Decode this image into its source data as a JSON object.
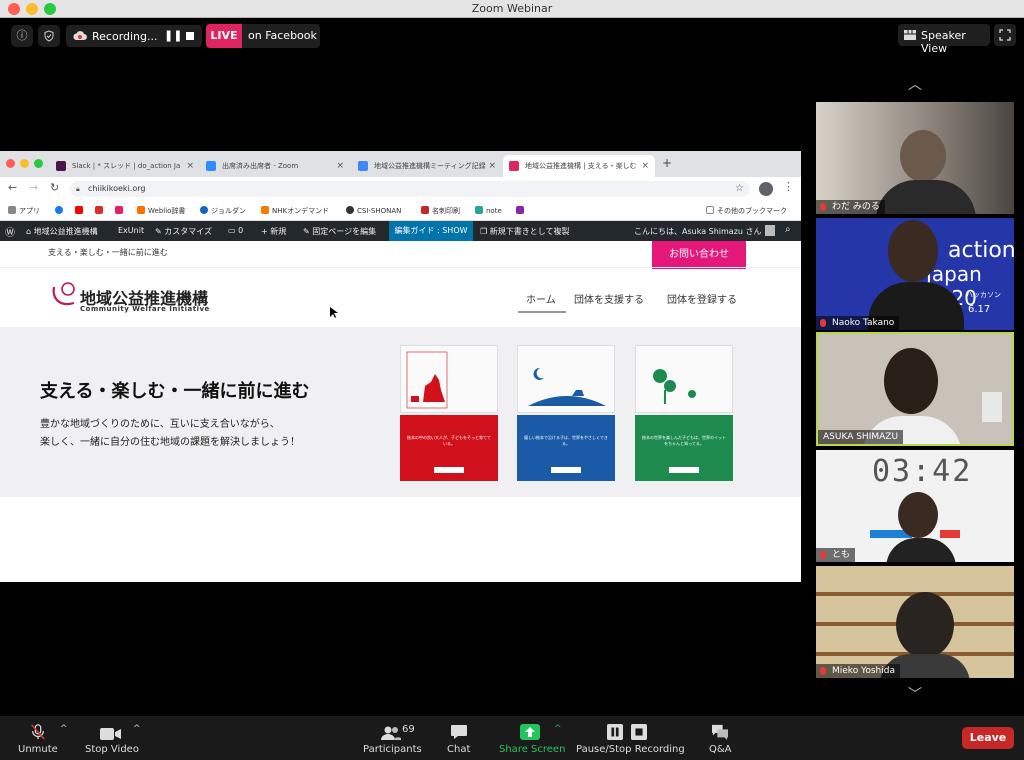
{
  "window": {
    "title": "Zoom Webinar"
  },
  "top_bar": {
    "recording_label": "Recording...",
    "live_label": "LIVE",
    "live_platform": "on Facebook",
    "view_label": "Speaker View"
  },
  "browser": {
    "tabs": [
      {
        "label": "Slack | * スレッド | do_action Ja",
        "favicon_color": "#4a154b"
      },
      {
        "label": "出席済み出席者 - Zoom",
        "favicon_color": "#2d8cff"
      },
      {
        "label": "地域公益推進機構ミーティング記録",
        "favicon_color": "#4285f4"
      },
      {
        "label": "地域公益推進機構 | 支える・楽しむ",
        "favicon_color": "#e0245e"
      }
    ],
    "new_tab": "+",
    "url": "chiikikoeki.org",
    "bookmarks": [
      {
        "label": "アプリ",
        "color": "#888888"
      },
      {
        "label": "",
        "color": "#1877f2"
      },
      {
        "label": "",
        "color": "#ff0000"
      },
      {
        "label": "",
        "color": "#d93025"
      },
      {
        "label": "",
        "color": "#e91e63"
      },
      {
        "label": "Weblio辞書",
        "color": "#ff6f00"
      },
      {
        "label": "ジョルダン",
        "color": "#1565c0"
      },
      {
        "label": "NHKオンデマンド",
        "color": "#f57c00"
      },
      {
        "label": "CSI-SHONAN",
        "color": "#333333"
      },
      {
        "label": "名刺印刷",
        "color": "#c62828"
      },
      {
        "label": "note",
        "color": "#26a69a"
      },
      {
        "label": "",
        "color": "#8e24aa"
      }
    ],
    "other_bookmarks": "その他のブックマーク",
    "wp_admin": {
      "site_name": "地域公益推進機構",
      "exunit": "ExUnit",
      "customize": "カスタマイズ",
      "comments": "0",
      "new": "新規",
      "edit_page": "固定ページを編集",
      "guide": "編集ガイド : SHOW",
      "duplicate": "新規下書きとして複製",
      "greeting": "こんにちは、Asuka Shimazu さん"
    },
    "site": {
      "tagline": "支える・楽しむ・一緒に前に進む",
      "contact": "お問い合わせ",
      "logo_ja": "地域公益推進機構",
      "logo_en": "Community Welfare Initiative",
      "nav": [
        "ホーム",
        "団体を支援する",
        "団体を登録する"
      ],
      "hero_title": "支える・楽しむ・一緒に前に進む",
      "hero_lines": [
        "豊かな地域づくりのために、互いに支え合いながら、",
        "楽しく、一緒に自分の住む地域の課題を解決しましょう！"
      ],
      "books": [
        {
          "cover_color": "#d0111b",
          "text": "絵本の中の良い大人が、子どもをそっと育てている。"
        },
        {
          "cover_color": "#1a5aa6",
          "text": "優しい絵本で泣ける子は、世界をやさしくできる。"
        },
        {
          "cover_color": "#1d8a4e",
          "text": "絵本の世界を楽しんだ子どもは、世界のイットをちゃんと知ってる。"
        }
      ]
    }
  },
  "participants": [
    {
      "name": "わだ みのる",
      "muted": true,
      "bg": "#5b5550"
    },
    {
      "name": "Naoko Takano",
      "muted": true,
      "bg": "#2436a8",
      "banner_line1": "action",
      "banner_line2": "Japan 2020",
      "banner_sub": "ハッカソン",
      "banner_date": "6.17"
    },
    {
      "name": "ASUKA SHIMAZU",
      "muted": false,
      "bg": "#c9c2b8",
      "active": true
    },
    {
      "name": "とも",
      "muted": true,
      "bg": "#f2f2f2",
      "timer": "03:42"
    },
    {
      "name": "Mieko Yoshida",
      "muted": false,
      "bg": "#b89a6a"
    }
  ],
  "controls": {
    "unmute": "Unmute",
    "stop_video": "Stop Video",
    "participants_label": "Participants",
    "participants_count": "69",
    "chat": "Chat",
    "share_screen": "Share Screen",
    "pause_stop": "Pause/Stop Recording",
    "qa": "Q&A",
    "leave": "Leave"
  }
}
